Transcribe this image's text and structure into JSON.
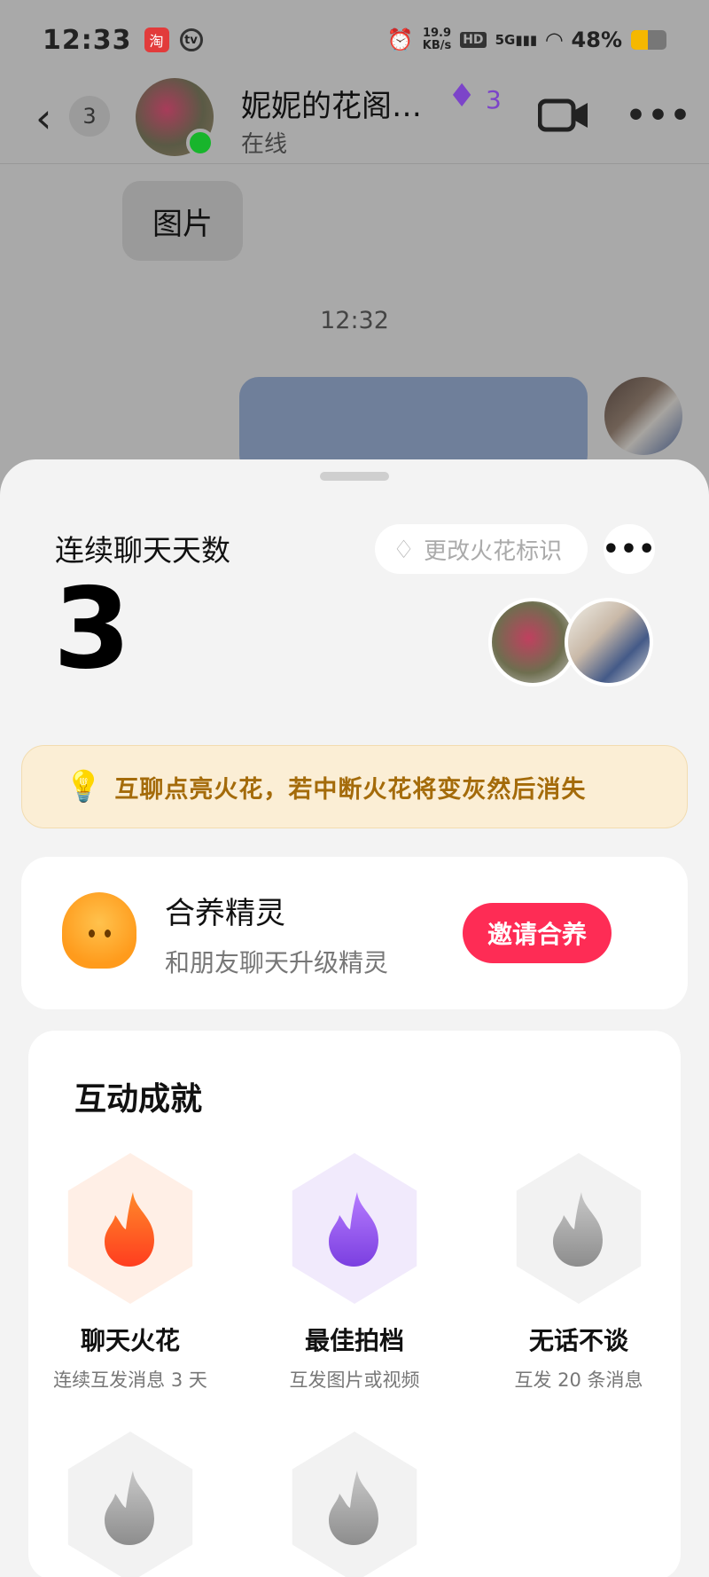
{
  "status_bar": {
    "time": "12:33",
    "app_icon_1": "淘",
    "app_icon_2": "tv",
    "network_speed_value": "19.9",
    "network_speed_unit": "KB/s",
    "hd_label": "HD",
    "signal_label": "5G",
    "battery_percent": "48%",
    "battery_level": 0.48
  },
  "chat_header": {
    "unread_count": "3",
    "contact_name": "妮妮的花阁…",
    "flame_count": "3",
    "status": "在线"
  },
  "chat": {
    "image_placeholder_text": "图片",
    "timestamp": "12:32"
  },
  "sheet": {
    "streak_label": "连续聊天天数",
    "streak_value": "3",
    "change_flame_label": "更改火花标识",
    "tip_text": "互聊点亮火花，若中断火花将变灰然后消失",
    "pet": {
      "title": "合养精灵",
      "subtitle": "和朋友聊天升级精灵",
      "button_label": "邀请合养"
    },
    "achievements": {
      "title": "互动成就",
      "items": [
        {
          "name": "聊天火花",
          "desc": "连续互发消息 3 天",
          "state": "active",
          "color": "#ff5a1f"
        },
        {
          "name": "最佳拍档",
          "desc": "互发图片或视频",
          "state": "active",
          "color": "#8b4fe8"
        },
        {
          "name": "无话不谈",
          "desc": "互发 20 条消息",
          "state": "locked",
          "color": "#9a9a9a"
        }
      ]
    }
  },
  "colors": {
    "accent_red": "#fe2c55",
    "tip_bg": "#fbeed5",
    "tip_text": "#a46b0a",
    "flame_purple": "#7c44c9",
    "online_green": "#18b52c"
  }
}
